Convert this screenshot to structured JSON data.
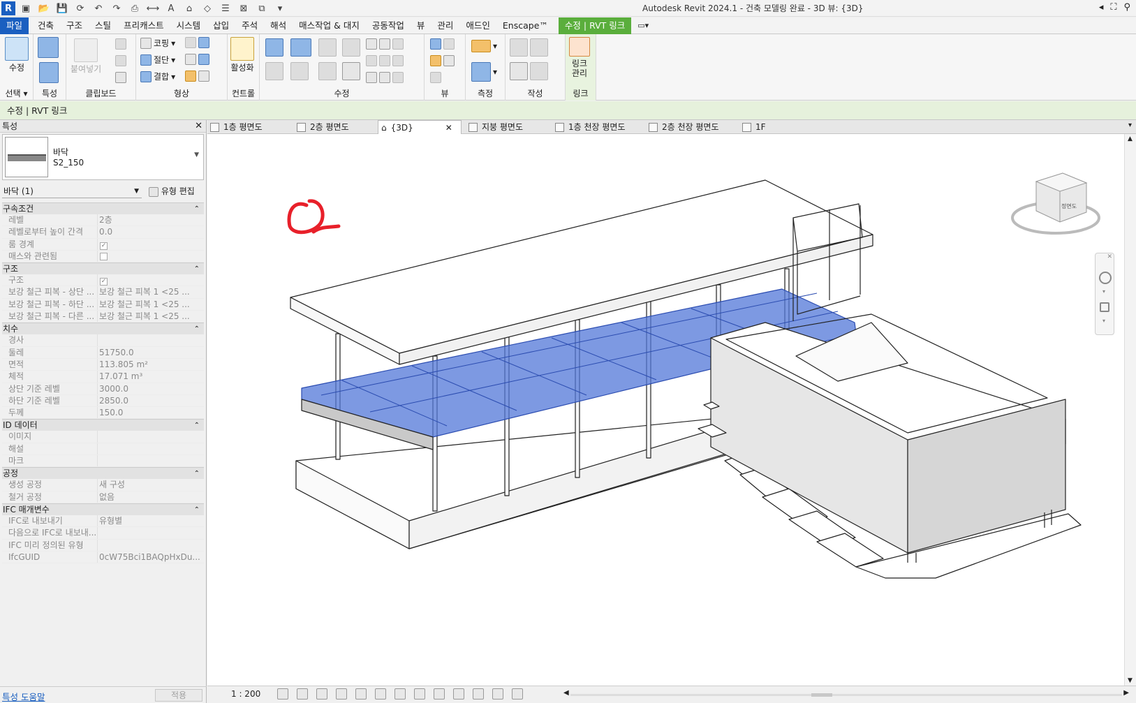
{
  "app": {
    "title": "Autodesk Revit 2024.1 - 건축 모델링 완료 - 3D 뷰: {3D}"
  },
  "menu": {
    "file": "파일",
    "items": [
      "건축",
      "구조",
      "스틸",
      "프리캐스트",
      "시스템",
      "삽입",
      "주석",
      "해석",
      "매스작업 & 대지",
      "공동작업",
      "뷰",
      "관리",
      "애드인",
      "Enscape™"
    ],
    "context_tab": "수정 | RVT 링크",
    "extra": "▭▾"
  },
  "ribbon": {
    "select": {
      "modify": "수정",
      "label": "선택"
    },
    "properties": {
      "label": "특성"
    },
    "clipboard": {
      "paste": "붙여넣기",
      "label": "클립보드"
    },
    "geometry": {
      "cope": "코핑",
      "cut": "절단",
      "join": "결합",
      "label": "형상"
    },
    "controls": {
      "activate": "활성화",
      "label": "컨트롤"
    },
    "modify": {
      "label": "수정"
    },
    "view": {
      "label": "뷰"
    },
    "measure": {
      "label": "측정"
    },
    "create": {
      "label": "작성"
    },
    "link": {
      "manage_line1": "링크",
      "manage_line2": "관리",
      "label": "링크"
    }
  },
  "status_context": "수정 | RVT 링크",
  "properties": {
    "header": "특성",
    "type_family": "바닥",
    "type_name": "S2_150",
    "instance_selector": "바닥 (1)",
    "edit_type": "유형 편집",
    "sections": [
      {
        "name": "구속조건",
        "rows": [
          {
            "k": "레벨",
            "v": "2층"
          },
          {
            "k": "레벨로부터 높이 간격",
            "v": "0.0"
          },
          {
            "k": "룸 경계",
            "v": "",
            "check": true
          },
          {
            "k": "매스와 관련됨",
            "v": "",
            "check": false
          }
        ]
      },
      {
        "name": "구조",
        "rows": [
          {
            "k": "구조",
            "v": "",
            "check": true
          },
          {
            "k": "보강 철근 피복 - 상단 ...",
            "v": "보강 철근 피복 1 <25 ..."
          },
          {
            "k": "보강 철근 피복 - 하단 ...",
            "v": "보강 철근 피복 1 <25 ..."
          },
          {
            "k": "보강 철근 피복 - 다른 ...",
            "v": "보강 철근 피복 1 <25 ..."
          }
        ]
      },
      {
        "name": "치수",
        "rows": [
          {
            "k": "경사",
            "v": ""
          },
          {
            "k": "둘레",
            "v": "51750.0"
          },
          {
            "k": "면적",
            "v": "113.805 m²"
          },
          {
            "k": "체적",
            "v": "17.071 m³"
          },
          {
            "k": "상단 기준 레벨",
            "v": "3000.0"
          },
          {
            "k": "하단 기준 레벨",
            "v": "2850.0"
          },
          {
            "k": "두께",
            "v": "150.0"
          }
        ]
      },
      {
        "name": "ID 데이터",
        "rows": [
          {
            "k": "이미지",
            "v": ""
          },
          {
            "k": "해설",
            "v": ""
          },
          {
            "k": "마크",
            "v": ""
          }
        ]
      },
      {
        "name": "공정",
        "rows": [
          {
            "k": "생성 공정",
            "v": "새 구성"
          },
          {
            "k": "철거 공정",
            "v": "없음"
          }
        ]
      },
      {
        "name": "IFC 매개변수",
        "rows": [
          {
            "k": "IFC로 내보내기",
            "v": "유형별"
          },
          {
            "k": "다음으로 IFC로 내보내...",
            "v": ""
          },
          {
            "k": "IFC 미리 정의된 유형",
            "v": ""
          },
          {
            "k": "IfcGUID",
            "v": "0cW75Bci1BAQpHxDu..."
          }
        ]
      }
    ],
    "help": "특성 도움말",
    "apply": "적용"
  },
  "tabs": [
    {
      "label": "1층 평면도"
    },
    {
      "label": "2층 평면도"
    },
    {
      "label": "{3D}",
      "active": true
    },
    {
      "label": "지붕 평면도"
    },
    {
      "label": "1층 천장 평면도"
    },
    {
      "label": "2층 천장 평면도"
    },
    {
      "label": "1F"
    }
  ],
  "view": {
    "scale": "1 : 200",
    "viewcube_face": "정면도"
  },
  "colors": {
    "file_tab": "#1a5fc0",
    "context_tab": "#5aae3c",
    "selection": "#4f74d6",
    "annotation": "#e8202a"
  }
}
